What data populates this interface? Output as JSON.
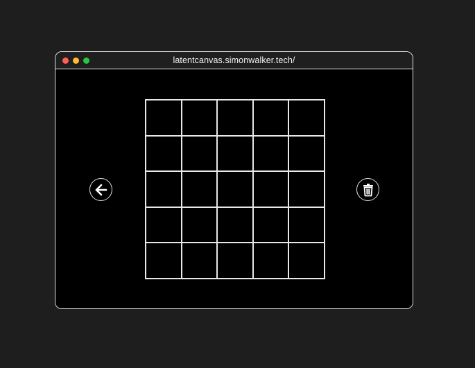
{
  "window": {
    "url": "latentcanvas.simonwalker.tech/"
  },
  "colors": {
    "page_background": "#1e1e1e",
    "canvas_background": "#000000",
    "grid_lines": "#e8e8e8",
    "traffic_red": "#ff5f57",
    "traffic_yellow": "#febc2e",
    "traffic_green": "#28c840"
  },
  "controls": {
    "back_icon": "arrow-left-icon",
    "clear_icon": "trash-icon"
  },
  "grid": {
    "rows": 5,
    "columns": 5,
    "filled_cells": 0
  }
}
